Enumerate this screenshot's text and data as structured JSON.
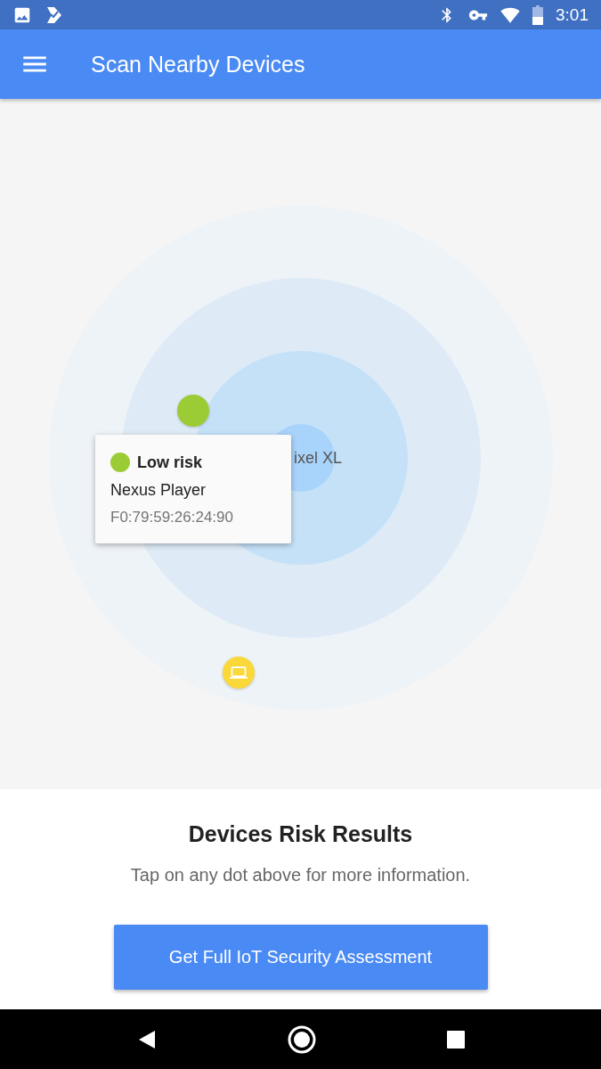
{
  "status_bar": {
    "time": "3:01"
  },
  "app_bar": {
    "title": "Scan Nearby Devices"
  },
  "radar": {
    "center_label": "ixel XL",
    "devices": [
      {
        "kind": "dot",
        "color": "#9ccc35"
      },
      {
        "kind": "laptop",
        "color": "#fbd83a"
      }
    ],
    "popup": {
      "risk": "Low risk",
      "color": "#9ccc35",
      "name": "Nexus Player",
      "address": "F0:79:59:26:24:90"
    }
  },
  "results": {
    "title": "Devices Risk Results",
    "hint": "Tap on any dot above for more information.",
    "button": "Get Full IoT Security Assessment"
  }
}
